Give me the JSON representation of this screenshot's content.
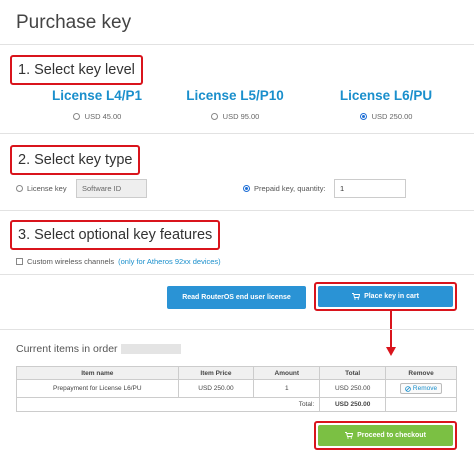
{
  "page": {
    "title": "Purchase key"
  },
  "sections": {
    "level": {
      "title": "1. Select key level"
    },
    "type": {
      "title": "2. Select key type"
    },
    "features": {
      "title": "3. Select optional key features"
    }
  },
  "licenses": [
    {
      "name": "License L4/P1",
      "price": "USD 45.00",
      "selected": false
    },
    {
      "name": "License L5/P10",
      "price": "USD 95.00",
      "selected": false
    },
    {
      "name": "License L6/PU",
      "price": "USD 250.00",
      "selected": true
    }
  ],
  "key_type": {
    "license_key_label": "License key",
    "software_id_placeholder": "Software ID",
    "prepaid_label": "Prepaid key, quantity:",
    "quantity": "1"
  },
  "features": {
    "wireless_label": "Custom wireless channels",
    "wireless_note": "(only for Atheros 92xx devices)"
  },
  "buttons": {
    "read_license": "Read RouterOS end user license",
    "place_in_cart": "Place key in cart",
    "checkout": "Proceed to checkout"
  },
  "cart": {
    "title": "Current items in order",
    "columns": [
      "Item name",
      "Item Price",
      "Amount",
      "Total",
      "Remove"
    ],
    "rows": [
      {
        "item": "Prepayment for License L6/PU",
        "price": "USD 250.00",
        "amount": "1",
        "total": "USD 250.00",
        "remove": "Remove"
      }
    ],
    "total_label": "Total:",
    "total_value": "USD 250.00"
  },
  "colors": {
    "highlight": "#d9141c",
    "accent": "#1a8fcc",
    "primary_button": "#2a93d5",
    "checkout_button": "#7bc043"
  }
}
